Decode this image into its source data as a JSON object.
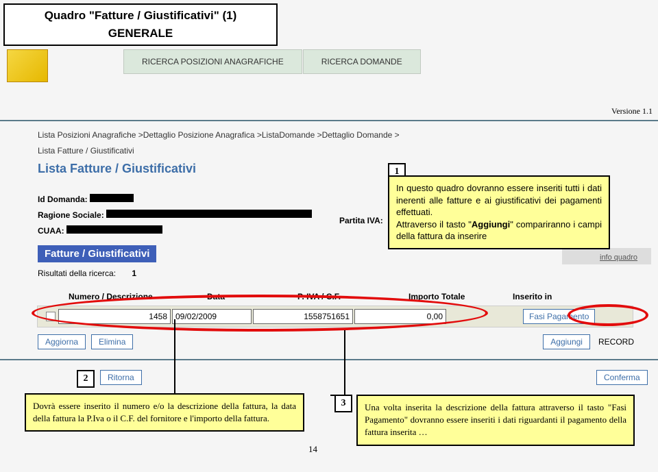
{
  "slide_title": {
    "line1": "Quadro \"Fatture / Giustificativi\" (1)",
    "line2": "GENERALE"
  },
  "tabs": {
    "ricerca_pos": "RICERCA POSIZIONI ANAGRAFICHE",
    "ricerca_dom": "RICERCA DOMANDE"
  },
  "version": "Versione 1.1",
  "breadcrumb": {
    "trail": "Lista Posizioni Anagrafiche >Dettaglio Posizione Anagrafica >ListaDomande >Dettaglio Domande >",
    "current": "Lista Fatture / Giustificativi"
  },
  "heading": "Lista Fatture / Giustificativi",
  "labels": {
    "id_domanda": "Id Domanda:",
    "ragione": "Ragione Sociale:",
    "cuaa": "CUAA:",
    "partita_iva": "Partita IVA:",
    "fatture_section": "Fatture / Giustificativi",
    "risultati": "Risultati della ricerca:",
    "risultati_count": "1",
    "info_quadro": "info quadro"
  },
  "table": {
    "headers": {
      "numero": "Numero / Descrizione",
      "data": "Data",
      "piva": "P. IVA / C.F.",
      "importo": "Importo Totale",
      "inserito": "Inserito in"
    },
    "row": {
      "numero": "1458",
      "data": "09/02/2009",
      "piva": "1558751651",
      "importo": "0,00",
      "inserito": ""
    },
    "fasi_pagamento_btn": "Fasi Pagamento"
  },
  "buttons": {
    "aggiorna": "Aggiorna",
    "elimina": "Elimina",
    "aggiungi": "Aggiungi",
    "record": "RECORD",
    "ritorna": "Ritorna",
    "conferma": "Conferma"
  },
  "callouts": {
    "n1": "1",
    "t1a": "In questo quadro dovranno essere inseriti tutti i dati inerenti alle fatture e ai giustificativi dei pagamenti effettuati.",
    "t1b": "Attraverso il tasto \"",
    "t1c": "Aggiungi",
    "t1d": "\" compariranno i campi della fattura da inserire",
    "n2": "2",
    "t2": "Dovrà essere inserito il numero e/o la descrizione della fattura, la data della fattura la P.Iva o il C.F. del fornitore e l'importo della fattura.",
    "n3": "3",
    "t3": "Una volta inserita la descrizione della fattura attraverso il tasto \"Fasi Pagamento\" dovranno essere inseriti i dati riguardanti il pagamento della fattura inserita …"
  },
  "page_number": "14"
}
